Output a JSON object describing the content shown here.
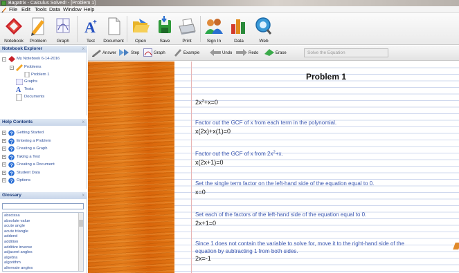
{
  "window": {
    "title": "Bagatrix - Calculus Solved! - [Problem 1]"
  },
  "menu": [
    "File",
    "Edit",
    "Tools",
    "Data",
    "Window",
    "Help"
  ],
  "toolbar": [
    {
      "label": "Notebook",
      "icon": "notebook-icon"
    },
    {
      "label": "Problem",
      "icon": "problem-icon"
    },
    {
      "label": "Graph",
      "icon": "graph-icon"
    },
    {
      "label": "Test",
      "icon": "test-icon"
    },
    {
      "label": "Document",
      "icon": "document-icon"
    },
    {
      "label": "Open",
      "icon": "folder-open-icon"
    },
    {
      "label": "Save",
      "icon": "save-icon"
    },
    {
      "label": "Print",
      "icon": "printer-icon"
    },
    {
      "label": "Sign In",
      "icon": "users-icon"
    },
    {
      "label": "Data",
      "icon": "bar-chart-icon"
    },
    {
      "label": "Web",
      "icon": "globe-search-icon"
    }
  ],
  "explorer": {
    "title": "Notebook Explorer",
    "close": "x",
    "root": "My Notebook 6-14-2016",
    "items": [
      "Problems",
      "Problem 1",
      "Graphs",
      "Tests",
      "Documents"
    ]
  },
  "help": {
    "title": "Help Contents",
    "close": "x",
    "items": [
      "Getting Started",
      "Entering a Problem",
      "Creating a Graph",
      "Taking a Test",
      "Creating a Document",
      "Student Data",
      "Options"
    ]
  },
  "glossary": {
    "title": "Glossary",
    "close": "x",
    "search_value": "",
    "items": [
      "abscissa",
      "absolute value",
      "acute angle",
      "acute triangle",
      "addend",
      "addition",
      "additive inverse",
      "adjacent angles",
      "algebra",
      "algorithm",
      "alternate angles"
    ]
  },
  "solver_toolbar": {
    "answer": "Answer",
    "step": "Step",
    "graph": "Graph",
    "example": "Example",
    "undo": "Undo",
    "redo": "Redo",
    "erase": "Erase",
    "solve": "Solve the Equation"
  },
  "problem": {
    "title": "Problem 1",
    "lines": [
      {
        "kind": "math",
        "text": "2x²+x=0"
      },
      {
        "kind": "step",
        "text": "Factor out the GCF of x from each term in the polynomial."
      },
      {
        "kind": "math",
        "text": "x(2x)+x(1)=0"
      },
      {
        "kind": "step",
        "text": "Factor out the GCF of x from 2x²+x."
      },
      {
        "kind": "math",
        "text": "x(2x+1)=0"
      },
      {
        "kind": "step",
        "text": "Set the single term factor on the left-hand side of the equation equal to 0."
      },
      {
        "kind": "math",
        "text": "x=0"
      },
      {
        "kind": "step",
        "text": "Set each of the factors of the left-hand side of the equation equal to 0."
      },
      {
        "kind": "math",
        "text": "2x+1=0"
      },
      {
        "kind": "step",
        "text": "Since 1 does not contain the variable to solve for, move it to the right-hand side of the"
      },
      {
        "kind": "step",
        "text": "equation by subtracting 1 from both sides."
      },
      {
        "kind": "math",
        "text": "2x=-1"
      }
    ]
  }
}
